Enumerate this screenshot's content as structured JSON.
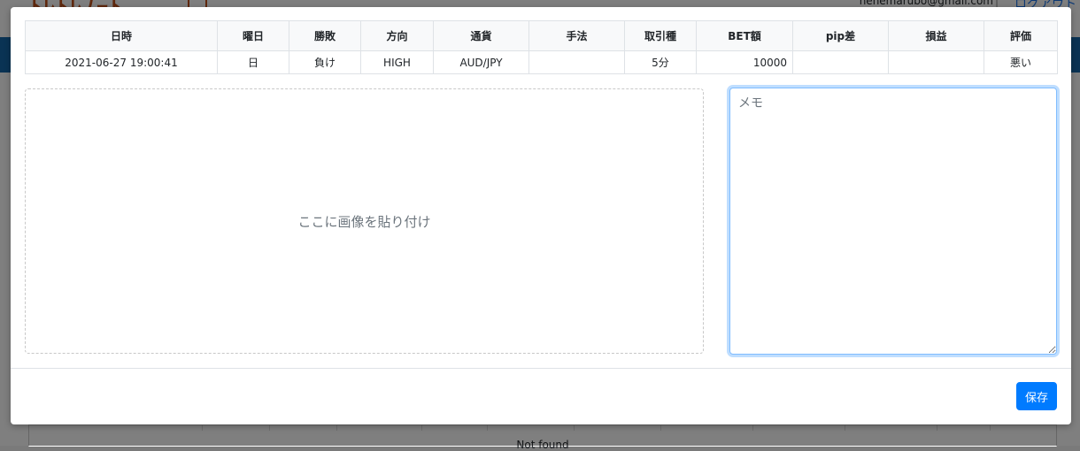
{
  "background": {
    "logo_text": "ﾄﾚﾄﾚﾉｰﾄ",
    "user_email": "hehemarubo@gmail.com",
    "separator": "|",
    "logout_label": "ログアウト",
    "not_found_text": "Not found"
  },
  "trade_table": {
    "headers": [
      "日時",
      "曜日",
      "勝敗",
      "方向",
      "通貨",
      "手法",
      "取引種",
      "BET額",
      "pip差",
      "損益",
      "評価"
    ],
    "row": [
      "2021-06-27 19:00:41",
      "日",
      "負け",
      "HIGH",
      "AUD/JPY",
      "",
      "5分",
      "10000",
      "",
      "",
      "悪い"
    ]
  },
  "paste_area": {
    "text": "ここに画像を貼り付け"
  },
  "memo": {
    "placeholder": "メモ",
    "value": ""
  },
  "footer": {
    "save_label": "保存"
  },
  "colors": {
    "primary": "#007bff",
    "navbar": "#1466a8",
    "logo": "#c0501a"
  }
}
